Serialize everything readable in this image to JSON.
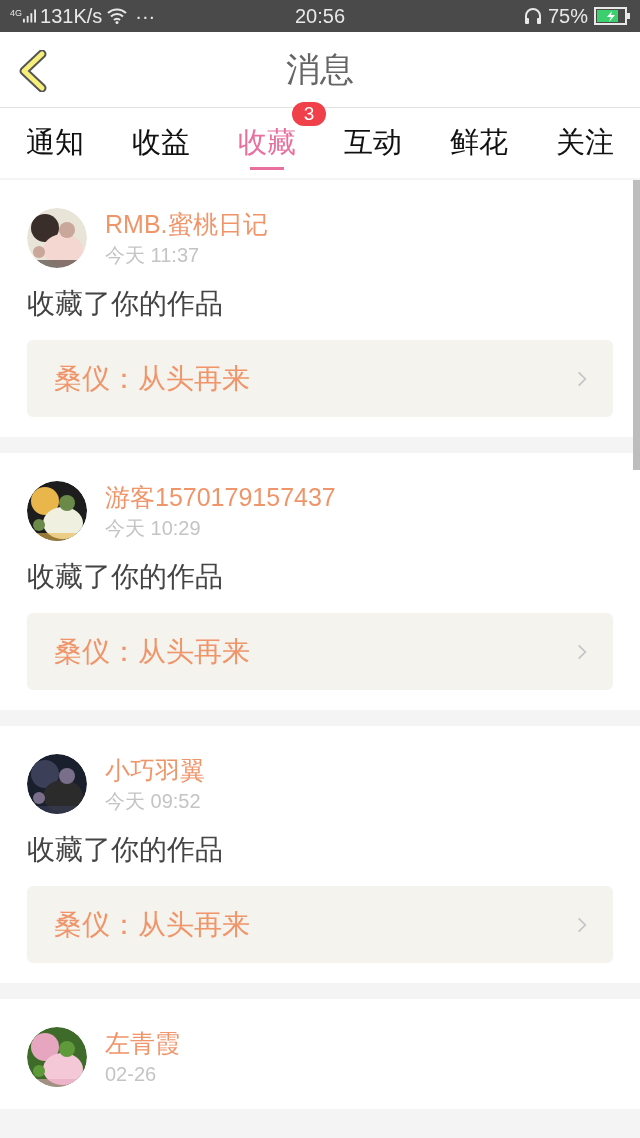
{
  "status_bar": {
    "network": "4G",
    "speed": "131K/s",
    "dots": "···",
    "time": "20:56",
    "battery": "75%"
  },
  "header": {
    "title": "消息"
  },
  "tabs": [
    {
      "label": "通知",
      "selected": false
    },
    {
      "label": "收益",
      "selected": false
    },
    {
      "label": "收藏",
      "selected": true,
      "badge": "3"
    },
    {
      "label": "互动",
      "selected": false
    },
    {
      "label": "鲜花",
      "selected": false
    },
    {
      "label": "关注",
      "selected": false
    }
  ],
  "messages": [
    {
      "user": "RMB.蜜桃日记",
      "time": "今天 11:37",
      "action": "收藏了你的作品",
      "work": "桑仪：从头再来"
    },
    {
      "user": "游客1570179157437",
      "time": "今天 10:29",
      "action": "收藏了你的作品",
      "work": "桑仪：从头再来"
    },
    {
      "user": "小巧羽翼",
      "time": "今天 09:52",
      "action": "收藏了你的作品",
      "work": "桑仪：从头再来"
    },
    {
      "user": "左青霞",
      "time": "02-26"
    }
  ]
}
